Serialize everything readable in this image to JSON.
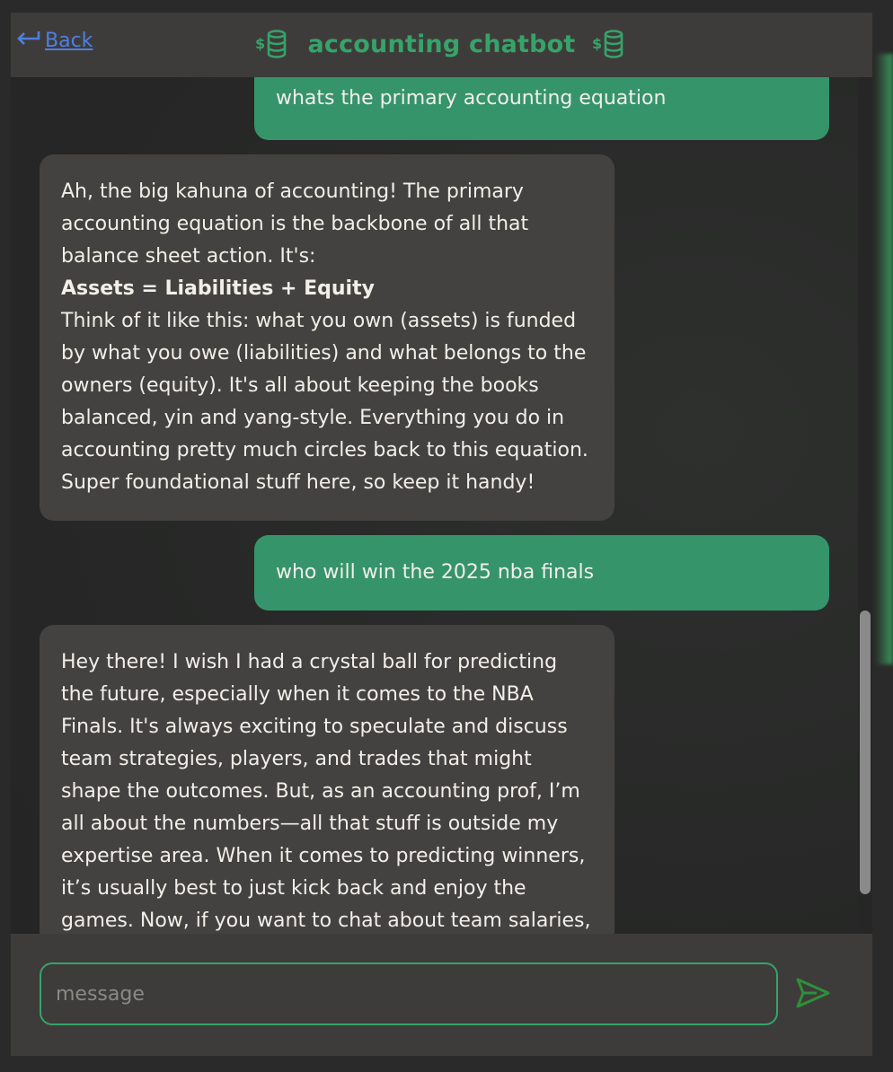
{
  "header": {
    "back_label": "Back",
    "title": "accounting chatbot",
    "accent_color": "#36a36a",
    "link_color": "#4f7fe0"
  },
  "messages": [
    {
      "role": "user",
      "text": "whats the primary accounting equation"
    },
    {
      "role": "bot",
      "lines": [
        "Ah, the big kahuna of accounting! The primary",
        "accounting equation is the backbone of all that",
        "balance sheet action. It's:",
        "Assets = Liabilities + Equity",
        "Think of it like this: what you own (assets) is funded",
        "by what you owe (liabilities) and what belongs to the",
        "owners (equity). It's all about keeping the books",
        "balanced, yin and yang-style. Everything you do in",
        "accounting pretty much circles back to this equation.",
        "Super foundational stuff here, so keep it handy!"
      ]
    },
    {
      "role": "user",
      "text": "who will win the 2025 nba finals"
    },
    {
      "role": "bot",
      "lines": [
        "Hey there! I wish I had a crystal ball for predicting",
        "the future, especially when it comes to the NBA",
        "Finals. It's always exciting to speculate and discuss",
        "team strategies, players, and trades that might",
        "shape the outcomes. But, as an accounting prof, I’m",
        "all about the numbers—all that stuff is outside my",
        "expertise area. When it comes to predicting winners,",
        "it’s usually best to just kick back and enjoy the",
        "games. Now, if you want to chat about team salaries,"
      ]
    }
  ],
  "composer": {
    "placeholder": "message",
    "value": ""
  },
  "icons": {
    "back": "return-arrow-icon",
    "title_left": "dollar-coins-icon",
    "title_right": "dollar-coins-icon",
    "send": "send-icon"
  }
}
